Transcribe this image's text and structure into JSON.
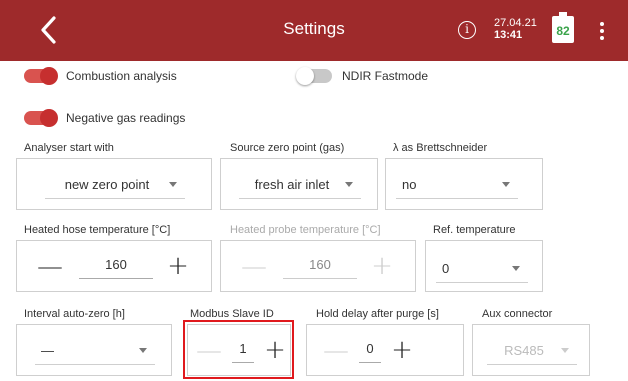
{
  "header": {
    "title": "Settings",
    "date": "27.04.21",
    "time": "13:41",
    "battery_level": "82",
    "info_glyph": "i"
  },
  "toggles": {
    "combustion_analysis": {
      "label": "Combustion analysis",
      "state": "on"
    },
    "ndir_fastmode": {
      "label": "NDIR Fastmode",
      "state": "off"
    },
    "negative_gas_readings": {
      "label": "Negative gas readings",
      "state": "on"
    }
  },
  "fields": {
    "analyser_start": {
      "label": "Analyser start with",
      "value": "new zero point"
    },
    "source_zero_point": {
      "label": "Source zero point (gas)",
      "value": "fresh air inlet"
    },
    "lambda_brettschneider": {
      "label": "λ as Brettschneider",
      "value": "no"
    },
    "heated_hose_temperature": {
      "label": "Heated hose temperature [°C]",
      "value": "160",
      "minus": "—",
      "plus": "+"
    },
    "heated_probe_temperature": {
      "label": "Heated probe temperature [°C]",
      "value": "160",
      "minus": "—",
      "plus": "+"
    },
    "ref_temperature": {
      "label": "Ref. temperature",
      "value": "0"
    },
    "interval_auto_zero": {
      "label": "Interval auto-zero [h]",
      "value": "—"
    },
    "modbus_slave_id": {
      "label": "Modbus Slave ID",
      "value": "1",
      "minus": "—",
      "plus": "+"
    },
    "hold_delay_after_purge": {
      "label": "Hold delay after purge [s]",
      "value": "0",
      "minus": "—",
      "plus": "+"
    },
    "aux_connector": {
      "label": "Aux connector",
      "value": "RS485"
    }
  },
  "colors": {
    "header_bg": "#9e2a2b",
    "toggle_on": "#c62f2f",
    "highlight": "#e0191d"
  }
}
